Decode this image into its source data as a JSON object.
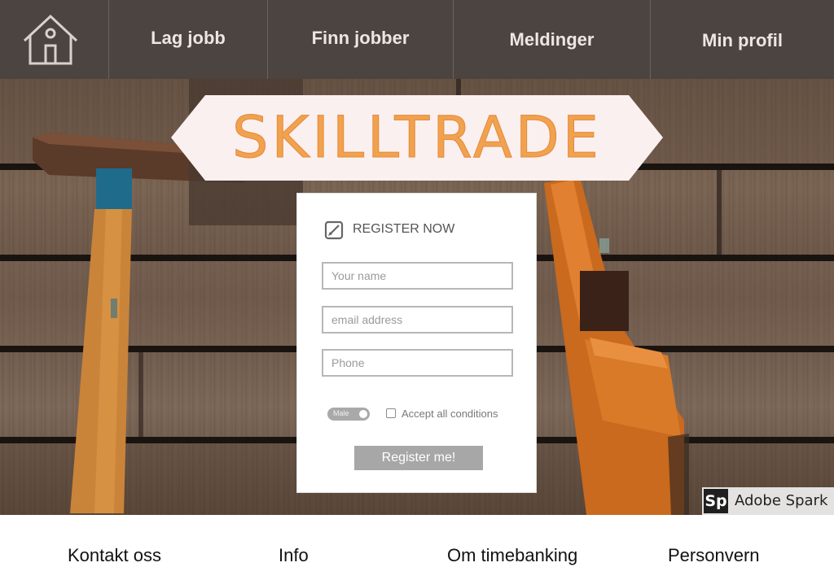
{
  "nav": {
    "home_icon": "home-icon",
    "items": [
      {
        "label": "Lag jobb"
      },
      {
        "label": "Finn jobber"
      },
      {
        "label": "Meldinger"
      },
      {
        "label": "Min profil"
      }
    ]
  },
  "hero": {
    "logo_text": "SKILLTRADE"
  },
  "register": {
    "icon": "edit-icon",
    "title": "REGISTER NOW",
    "fields": {
      "name": {
        "placeholder": "Your name",
        "value": ""
      },
      "email": {
        "placeholder": "email address",
        "value": ""
      },
      "phone": {
        "placeholder": "Phone",
        "value": ""
      }
    },
    "toggle_label": "Male",
    "checkbox_label": "Accept all conditions",
    "checkbox_checked": false,
    "button_label": "Register me!"
  },
  "badge": {
    "logo": "Sp",
    "text": "Adobe Spark"
  },
  "footer": {
    "links": [
      {
        "label": "Kontakt oss"
      },
      {
        "label": "Info"
      },
      {
        "label": "Om timebanking"
      },
      {
        "label": "Personvern"
      }
    ]
  },
  "colors": {
    "nav_bg": "#4c4440",
    "nav_text": "#ece7e3",
    "logo_orange": "#f0a24e",
    "banner_bg": "#faf0f0",
    "button_bg": "#a7a7a7"
  }
}
